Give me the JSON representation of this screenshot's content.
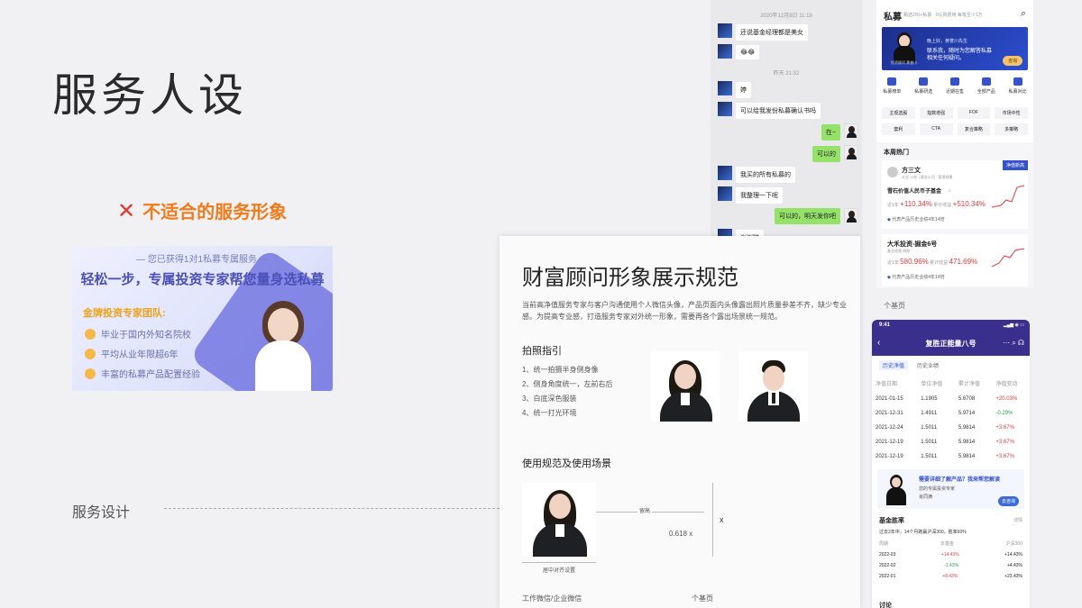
{
  "slide": {
    "title": "服务人设",
    "bad_label": "不适合的服务形象",
    "section_label": "服务设计"
  },
  "banner": {
    "top": "— 您已获得1对1私募专属服务 —",
    "headline": "轻松一步，专属投资专家帮您量身选私募",
    "team": "金牌投资专家团队:",
    "items": [
      "毕业于国内外知名院校",
      "平均从业年限超6年",
      "丰富的私募产品配置经验"
    ]
  },
  "chat": {
    "time1": "2020年12月8日 11:18",
    "time2": "昨天 21:32",
    "messages": [
      {
        "side": "left",
        "text": "还说基金经理都是美女"
      },
      {
        "side": "left",
        "text": "😂😂"
      },
      {
        "side": "left",
        "text": "婷"
      },
      {
        "side": "left",
        "text": "可以给我发份私募确认书吗"
      },
      {
        "side": "right",
        "text": "在~"
      },
      {
        "side": "right",
        "text": "可以的"
      },
      {
        "side": "left",
        "text": "我买的所有私募的"
      },
      {
        "side": "left",
        "text": "我整理一下呢"
      },
      {
        "side": "right",
        "text": "可以的，明天发你吧"
      },
      {
        "side": "left",
        "text": "谢谢啦"
      }
    ]
  },
  "card": {
    "title": "财富顾问形象展示规范",
    "description": "当前高净值服务专家与客户沟通使用个人微信头像，产品页面内头像露出照片质量参差不齐，缺少专业感。为提高专业感，打造服务专家对外统一形象，需要再各个露出场景统一规范。",
    "photo_guide_title": "拍照指引",
    "photo_guide": [
      "1、统一拍摄半身侧身像",
      "2、侧身角度统一，左前右后",
      "3、白底深色服装",
      "4、统一打光环境"
    ],
    "usage_title": "使用规范及使用场景",
    "dim_label": "留高",
    "ratio_label": "0.618 x",
    "x_label": "x",
    "center_label": "居中对齐设置",
    "scenario_left": "工作微信/企业微信",
    "scenario_right": "个基页"
  },
  "right_app": {
    "title": "私募",
    "subtitle": "甄选200+私募 · 0认购费用 每笔至少1万",
    "hero_line1": "晚上好，黄誉川先生",
    "hero_line2": "联系我，随时为您解答私募",
    "hero_line3": "相关任何疑问。",
    "hero_name": "投资顾问 黄誉川",
    "hero_button": "咨询",
    "nav": [
      "私募榜单",
      "私募研选",
      "近期在售",
      "全部产品",
      "私募对比"
    ],
    "tags": [
      "主观选股",
      "指数增强",
      "FOF",
      "市场中性",
      "套利",
      "CTA",
      "复合策略",
      "多策略"
    ],
    "hot_title": "本周热门",
    "hot1": {
      "manager": "方三文",
      "manager_sub": "从业 14年 | 基金公司 · 管理规模",
      "badge": "净值新高",
      "fund": "雪石价值人民币子基金",
      "fund_tag": "□",
      "r1_label": "近1年",
      "r1": "+110.34%",
      "r2_label": "累计收益",
      "r2": "+510.34%",
      "footer": "代表产品历史业绩4年14倍"
    },
    "hot2": {
      "fund": "大禾投资-掘金6号",
      "manager": "基金经理 胡昂",
      "r1_label": "近1年",
      "r1": "580.96%",
      "r2_label": "累计收益",
      "r2": "471.69%",
      "footer": "代表产品历史业绩4年14倍"
    },
    "footer": "个基页"
  },
  "phone": {
    "time": "9:41",
    "title": "复胜正能量八号",
    "tabs": [
      "历史净值",
      "历史业绩"
    ],
    "headers": [
      "净值日期",
      "单位净值",
      "累计净值",
      "净值变动"
    ],
    "rows": [
      [
        "2021-01-15",
        "1.1905",
        "5.6708",
        "+20.03%"
      ],
      [
        "2021-12-31",
        "1.4911",
        "5.9714",
        "-0.29%"
      ],
      [
        "2021-12-24",
        "1.5011",
        "5.9814",
        "+3.67%"
      ],
      [
        "2021-12-19",
        "1.5011",
        "5.9814",
        "+3.67%"
      ],
      [
        "2021-12-19",
        "1.5011",
        "5.9814",
        "+3.67%"
      ]
    ],
    "ask_title": "需要详细了解产品？我来帮您解读",
    "ask_sub": "您的专属投资专家",
    "ask_name": "肖同满",
    "ask_btn": "去咨询",
    "win_title": "基金胜率",
    "win_more": "详情",
    "win_desc": "过去2年中，14个月跑赢沪深300，胜率60%",
    "win_headers": [
      "周期",
      "本基金",
      "沪深300"
    ],
    "win_rows": [
      [
        "2022-03",
        "+14.43%",
        "+14.43%"
      ],
      [
        "2022-02",
        "-1.43%",
        "+4.43%"
      ],
      [
        "2022-01",
        "+8.43%",
        "+23.43%"
      ]
    ],
    "discuss": "讨论"
  }
}
